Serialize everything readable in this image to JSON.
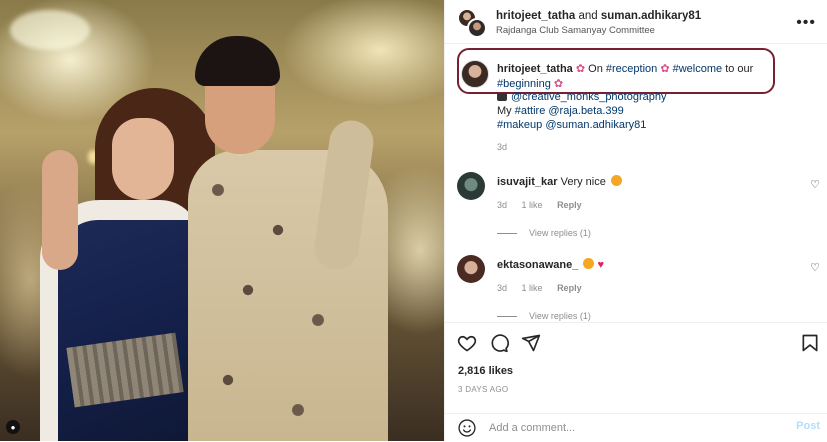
{
  "post": {
    "author1": "hritojeet_tatha",
    "joiner": "and",
    "author2": "suman.adhikary81",
    "location": "Rajdanga Club Samanyay Committee",
    "more_icon": "more-horizontal-icon"
  },
  "caption": {
    "username": "hritojeet_tatha",
    "text_on": "On",
    "tag_reception": "#reception",
    "tag_welcome": "#welcome",
    "text_to_our": "to our",
    "tag_beginning": "#beginning",
    "line_photo": "@creative_monks_photography",
    "line_attire_prefix": "My",
    "tag_attire": "#attire",
    "mention_attire": "@raja.beta.399",
    "tag_makeup": "#makeup",
    "mention_makeup": "@suman.adhikary81",
    "time": "3d",
    "highlight_color": "#7a1f33"
  },
  "comments": [
    {
      "username": "isuvajit_kar",
      "text": "Very nice",
      "time": "3d",
      "likes": "1 like",
      "reply": "Reply",
      "view_replies": "View replies (1)"
    },
    {
      "username": "ektasonawane_",
      "text": "",
      "time": "3d",
      "likes": "1 like",
      "reply": "Reply",
      "view_replies": "View replies (1)"
    }
  ],
  "footer": {
    "likes_count": "2,816 likes",
    "posted_ago": "3 DAYS AGO",
    "comment_placeholder": "Add a comment...",
    "post_label": "Post"
  },
  "colors": {
    "link": "#00376b",
    "muted": "#8e8e8e",
    "post_button_disabled": "#b2dffc"
  }
}
